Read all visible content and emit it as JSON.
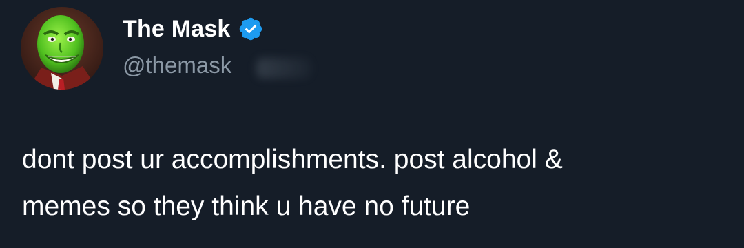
{
  "author": {
    "display_name": "The Mask",
    "handle": "@themask",
    "verified": true,
    "avatar_icon": "green-mask-face-avatar"
  },
  "tweet": {
    "text": "dont post ur accomplishments. post alcohol &\nmemes so they think u have no future"
  },
  "colors": {
    "background": "#151d28",
    "name": "#ffffff",
    "handle": "#8b98a5",
    "verified_badge": "#1d9bf0",
    "text": "#ffffff"
  }
}
